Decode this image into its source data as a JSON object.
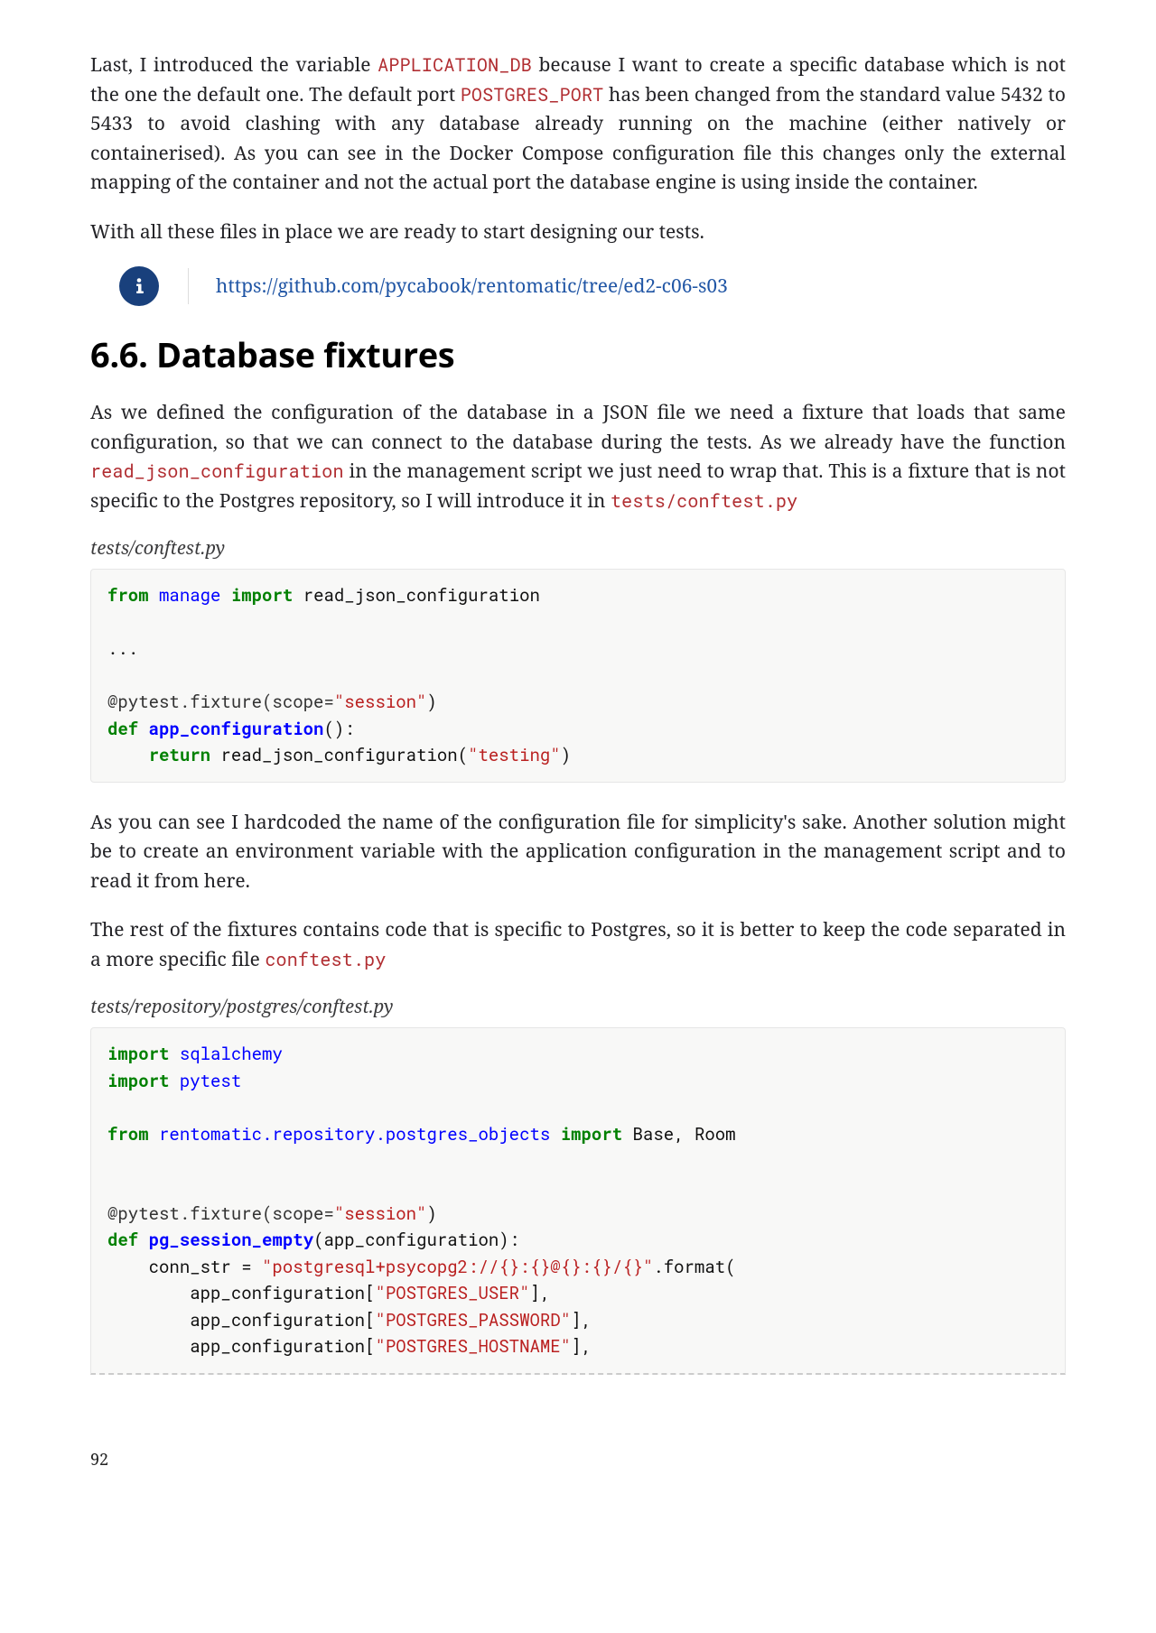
{
  "para1_pre": "Last, I introduced the variable ",
  "para1_code1": "APPLICATION_DB",
  "para1_mid": " because I want to create a specific database which is not the one the default one. The default port ",
  "para1_code2": "POSTGRES_PORT",
  "para1_post": " has been changed from the standard value 5432 to 5433 to avoid clashing with any database already running on the machine (either natively or containerised). As you can see in the Docker Compose configuration file this changes only the external mapping of the container and not the actual port the database engine is using inside the container.",
  "para2": "With all these files in place we are ready to start designing our tests.",
  "admonition_link": "https://github.com/pycabook/rentomatic/tree/ed2-c06-s03",
  "section_heading": "6.6. Database fixtures",
  "para3_pre": "As we defined the configuration of the database in a JSON file we need a fixture that loads that same configuration, so that we can connect to the database during the tests. As we already have the function ",
  "para3_code1": "read_json_configuration",
  "para3_mid": " in the management script we just need to wrap that. This is a fixture that is not specific to the Postgres repository, so I will introduce it in ",
  "para3_code2": "tests/conftest.py",
  "codeblock1_title": "tests/conftest.py",
  "code1": {
    "l1_kw1": "from",
    "l1_name": "manage",
    "l1_kw2": "import",
    "l1_rest": " read_json_configuration",
    "l3": "...",
    "l5_dec": "@pytest.fixture(scope=",
    "l5_str": "\"session\"",
    "l5_close": ")",
    "l6_kw": "def",
    "l6_fn": "app_configuration",
    "l6_rest": "():",
    "l7_indent": "    ",
    "l7_kw": "return",
    "l7_rest": " read_json_configuration(",
    "l7_str": "\"testing\"",
    "l7_close": ")"
  },
  "para4": "As you can see I hardcoded the name of the configuration file for simplicity's sake. Another solution might be to create an environment variable with the application configuration in the management script and to read it from here.",
  "para5_pre": "The rest of the fixtures contains code that is specific to Postgres, so it is better to keep the code separated in a more specific file ",
  "para5_code": "conftest.py",
  "codeblock2_title": "tests/repository/postgres/conftest.py",
  "code2": {
    "l1_kw": "import",
    "l1_name": "sqlalchemy",
    "l2_kw": "import",
    "l2_name": "pytest",
    "l4_kw1": "from",
    "l4_name": "rentomatic.repository.postgres_objects",
    "l4_kw2": "import",
    "l4_rest": " Base, Room",
    "l7_dec": "@pytest.fixture(scope=",
    "l7_str": "\"session\"",
    "l7_close": ")",
    "l8_kw": "def",
    "l8_fn": "pg_session_empty",
    "l8_rest": "(app_configuration):",
    "l9_indent": "    ",
    "l9_a": "conn_str = ",
    "l9_str": "\"postgresql+psycopg2://{}:{}@{}:{}/{}\"",
    "l9_b": ".format(",
    "l10_indent": "        ",
    "l10_a": "app_configuration[",
    "l10_str": "\"POSTGRES_USER\"",
    "l10_b": "],",
    "l11_indent": "        ",
    "l11_a": "app_configuration[",
    "l11_str": "\"POSTGRES_PASSWORD\"",
    "l11_b": "],",
    "l12_indent": "        ",
    "l12_a": "app_configuration[",
    "l12_str": "\"POSTGRES_HOSTNAME\"",
    "l12_b": "],"
  },
  "page_number": "92"
}
